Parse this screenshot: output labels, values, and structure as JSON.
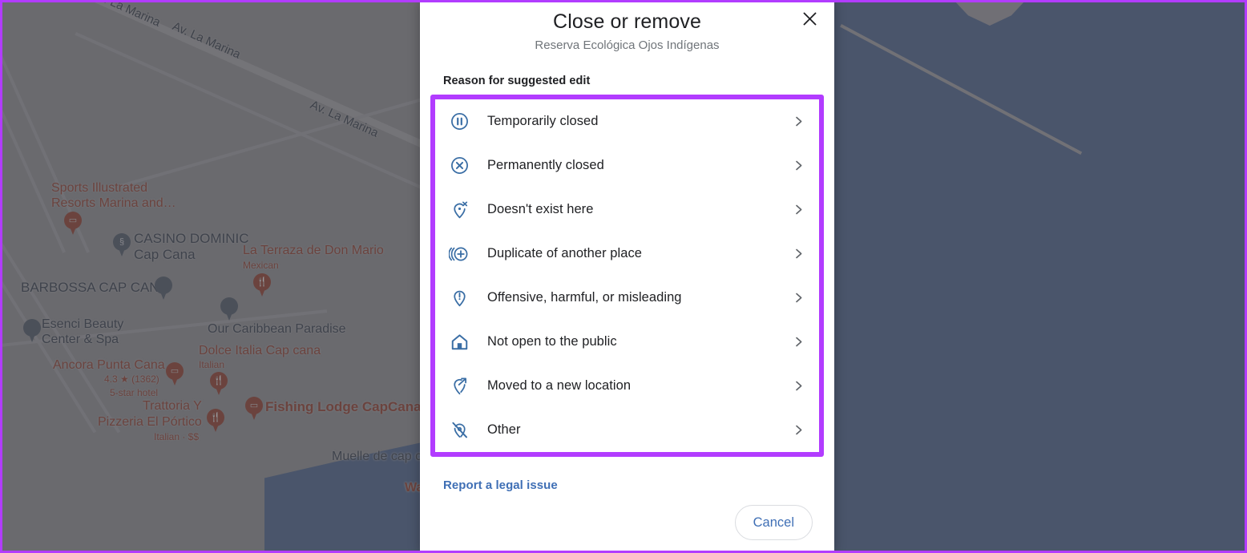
{
  "dialog": {
    "title": "Close or remove",
    "subtitle": "Reserva Ecológica Ojos Indígenas",
    "close_icon": "close-icon",
    "section_label": "Reason for suggested edit",
    "options": [
      {
        "label": "Temporarily closed",
        "icon": "pause-circle-icon",
        "chevron": "chevron-right-icon"
      },
      {
        "label": "Permanently closed",
        "icon": "x-circle-icon",
        "chevron": "chevron-right-icon"
      },
      {
        "label": "Doesn't exist here",
        "icon": "pin-remove-icon",
        "chevron": "chevron-right-icon"
      },
      {
        "label": "Duplicate of another place",
        "icon": "duplicate-place-icon",
        "chevron": "chevron-right-icon"
      },
      {
        "label": "Offensive, harmful, or misleading",
        "icon": "pin-exclamation-icon",
        "chevron": "chevron-right-icon"
      },
      {
        "label": "Not open to the public",
        "icon": "home-icon",
        "chevron": "chevron-right-icon"
      },
      {
        "label": "Moved to a new location",
        "icon": "pin-arrow-icon",
        "chevron": "chevron-right-icon"
      },
      {
        "label": "Other",
        "icon": "pin-slash-icon",
        "chevron": "chevron-right-icon"
      }
    ],
    "legal_link": "Report a legal issue",
    "cancel_label": "Cancel"
  },
  "highlight": {
    "color": "#b23cff"
  },
  "theme": {
    "icon_blue": "#3a6ea5",
    "link_blue": "#3f6fb5",
    "title_color": "#202124",
    "subtitle_color": "#70757a"
  },
  "map": {
    "roads": [
      {
        "label": "Av. La Marina"
      },
      {
        "label": "Av. La Marina"
      },
      {
        "label": "Av. La Marina"
      }
    ],
    "places": [
      {
        "name": "Sports Illustrated",
        "name2": "Resorts Marina and…",
        "kind": "red"
      },
      {
        "name": "CASINO DOMINIC",
        "name2": "Cap Cana",
        "kind": "gray"
      },
      {
        "name": "La Terraza de Don Mario",
        "name2": "Mexican",
        "kind": "red"
      },
      {
        "name": "BARBOSSA CAP CANA",
        "kind": "gray"
      },
      {
        "name": "Esenci Beauty",
        "name2": "Center & Spa",
        "kind": "gray"
      },
      {
        "name": "Our Caribbean Paradise",
        "kind": "gray"
      },
      {
        "name": "Dolce Italia Cap cana",
        "name2": "Italian",
        "kind": "red"
      },
      {
        "name": "Ancora Punta Cana",
        "name2": "4.3 ★ (1362)",
        "name3": "5-star hotel",
        "kind": "red"
      },
      {
        "name": "Trattoria Y",
        "name2": "Pizzeria El Pórtico",
        "name3": "Italian · $$",
        "kind": "red"
      },
      {
        "name": "Fishing Lodge CapCana",
        "kind": "red"
      },
      {
        "name": "Muelle de cap c",
        "kind": "label"
      },
      {
        "name": "Wa",
        "kind": "red"
      }
    ]
  }
}
